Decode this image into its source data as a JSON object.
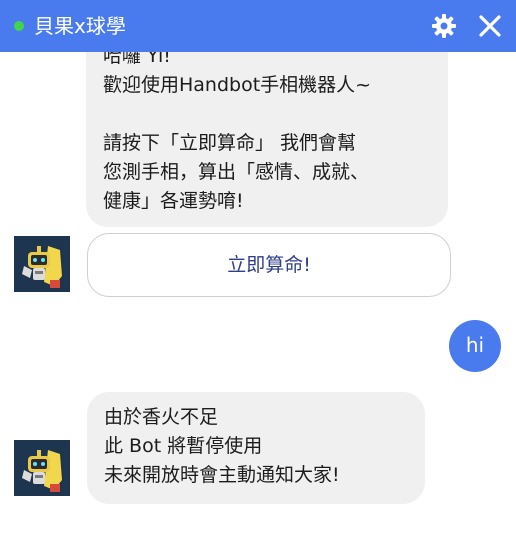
{
  "header": {
    "title": "貝果x球學",
    "status_color": "#42d44d",
    "bar_color": "#4a7bee",
    "settings_icon": "gear-icon",
    "close_icon": "close-icon"
  },
  "messages": {
    "bot_intro": {
      "lines": [
        "哈囉 Yi!",
        "歡迎使用Handbot手相機器人~",
        "",
        "請按下「立即算命」 我們會幫",
        "您測手相，算出「感情、成就、",
        "健康」各運勢唷!"
      ]
    },
    "quick_reply": {
      "label": "立即算命!"
    },
    "user_message": {
      "text": "hi"
    },
    "bot_notice": {
      "lines": [
        "由於香火不足",
        "此 Bot 將暫停使用",
        "未來開放時會主動通知大家!"
      ]
    }
  },
  "avatars": {
    "icon": "robot-hand-avatar"
  }
}
